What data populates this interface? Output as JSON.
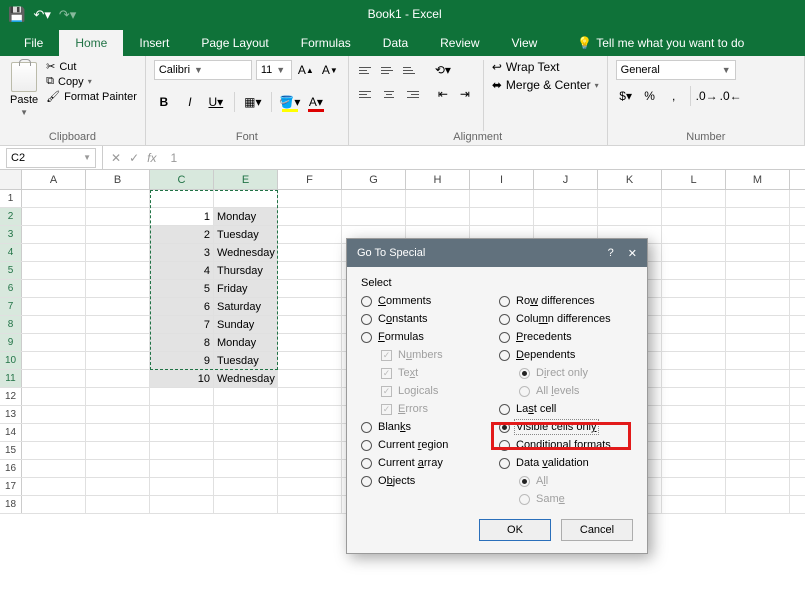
{
  "app": {
    "title": "Book1 - Excel"
  },
  "tabs": {
    "file": "File",
    "home": "Home",
    "insert": "Insert",
    "pagelayout": "Page Layout",
    "formulas": "Formulas",
    "data": "Data",
    "review": "Review",
    "view": "View",
    "tellme": "Tell me what you want to do"
  },
  "ribbon": {
    "clipboard": {
      "label": "Clipboard",
      "paste": "Paste",
      "cut": "Cut",
      "copy": "Copy",
      "fmtpainter": "Format Painter"
    },
    "font": {
      "label": "Font",
      "family": "Calibri",
      "size": "11"
    },
    "alignment": {
      "label": "Alignment",
      "wrap": "Wrap Text",
      "merge": "Merge & Center"
    },
    "number": {
      "label": "Number",
      "format": "General"
    }
  },
  "formula_bar": {
    "ref": "C2",
    "value": "1"
  },
  "columns": [
    "A",
    "B",
    "C",
    "E",
    "F",
    "G",
    "H",
    "I",
    "J",
    "K",
    "L",
    "M"
  ],
  "chart_data": {
    "type": "table",
    "columns": [
      "C",
      "E"
    ],
    "rows": [
      {
        "row": 2,
        "C": 1,
        "E": "Monday"
      },
      {
        "row": 3,
        "C": 2,
        "E": "Tuesday"
      },
      {
        "row": 4,
        "C": 3,
        "E": "Wednesday"
      },
      {
        "row": 5,
        "C": 4,
        "E": "Thursday"
      },
      {
        "row": 6,
        "C": 5,
        "E": "Friday"
      },
      {
        "row": 7,
        "C": 6,
        "E": "Saturday"
      },
      {
        "row": 8,
        "C": 7,
        "E": "Sunday"
      },
      {
        "row": 9,
        "C": 8,
        "E": "Monday"
      },
      {
        "row": 10,
        "C": 9,
        "E": "Tuesday"
      },
      {
        "row": 11,
        "C": 10,
        "E": "Wednesday"
      }
    ]
  },
  "dialog": {
    "title": "Go To Special",
    "section": "Select",
    "ok": "OK",
    "cancel": "Cancel",
    "opts": {
      "comments": "Comments",
      "constants": "Constants",
      "formulas": "Formulas",
      "numbers": "Numbers",
      "text": "Text",
      "logicals": "Logicals",
      "errors": "Errors",
      "blanks": "Blanks",
      "currentregion": "Current region",
      "currentarray": "Current array",
      "objects": "Objects",
      "rowdiff": "Row differences",
      "coldiff": "Column differences",
      "precedents": "Precedents",
      "dependents": "Dependents",
      "directonly": "Direct only",
      "alllevels": "All levels",
      "lastcell": "Last cell",
      "visible": "Visible cells only",
      "condfmt": "Conditional formats",
      "datavalidation": "Data validation",
      "all": "All",
      "same": "Same"
    }
  }
}
